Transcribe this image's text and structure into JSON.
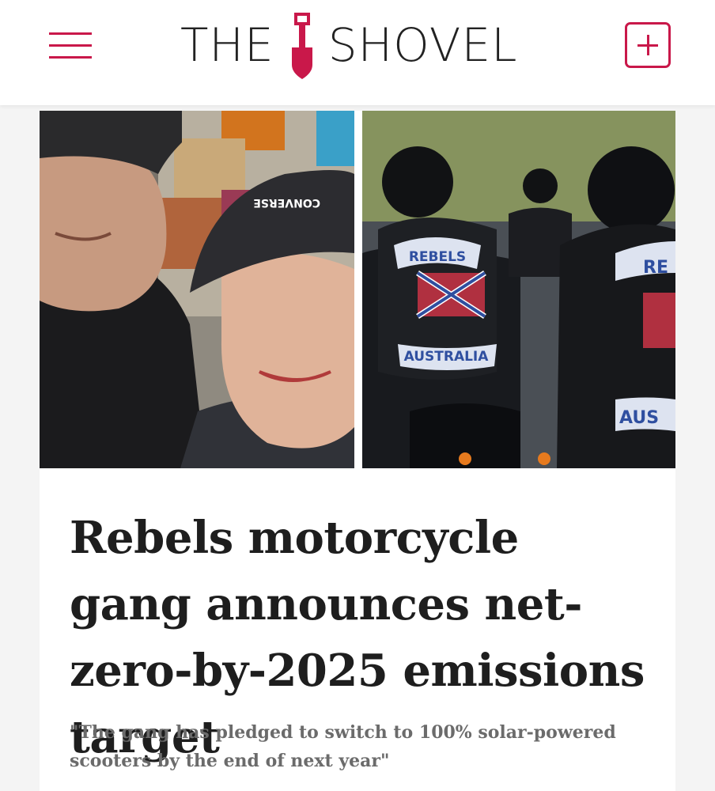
{
  "header": {
    "logo_left": "THE",
    "logo_right": "SHOVEL",
    "menu_icon": "hamburger-menu-icon",
    "add_icon": "plus-icon",
    "accent_color": "#c9184a"
  },
  "article": {
    "headline": "Rebels motorcycle gang announces net-zero-by-2025 emissions target",
    "standfirst": "\"The gang has pledged to switch to 100% solar-powered scooters by the end of next year\"",
    "photo_left": {
      "cap_text": "CONVERSE"
    },
    "photo_right": {
      "patch_top": "REBELS",
      "patch_bottom": "AUSTRALIA",
      "patch_right_top": "RE",
      "patch_right_bottom": "AUS"
    }
  }
}
